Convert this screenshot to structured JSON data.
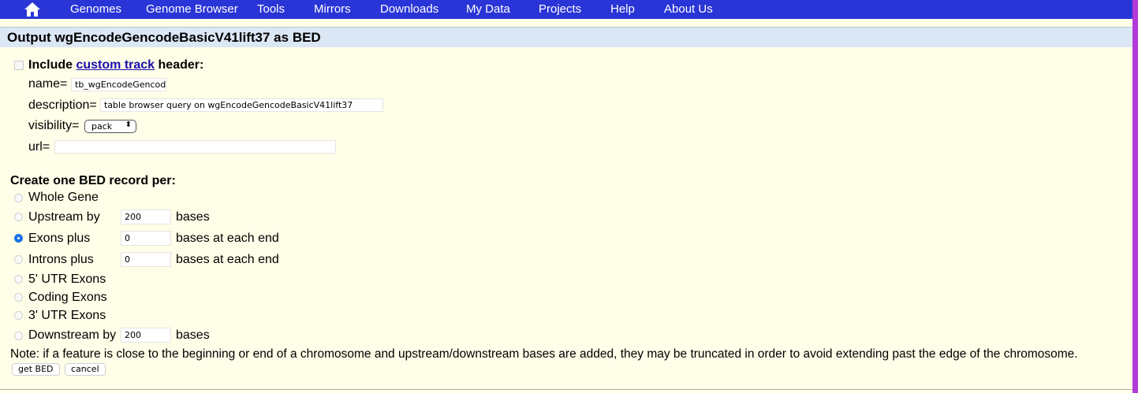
{
  "nav": {
    "items": [
      "Genomes",
      "Genome Browser",
      "Tools",
      "Mirrors",
      "Downloads",
      "My Data",
      "Projects",
      "Help",
      "About Us"
    ]
  },
  "page_title": "Output wgEncodeGencodeBasicV41lift37 as BED",
  "header_section": {
    "include_prefix": "Include",
    "include_link": "custom track",
    "include_suffix": "header:",
    "name_label": "name=",
    "name_value": "tb_wgEncodeGencode",
    "description_label": "description=",
    "description_value": "table browser query on wgEncodeGencodeBasicV41lift37",
    "visibility_label": "visibility=",
    "visibility_value": "pack",
    "url_label": "url=",
    "url_value": ""
  },
  "records": {
    "heading": "Create one BED record per:",
    "options": [
      {
        "label": "Whole Gene",
        "value": null,
        "suffix": null,
        "selected": false
      },
      {
        "label": "Upstream by",
        "value": "200",
        "suffix": "bases",
        "selected": false
      },
      {
        "label": "Exons plus",
        "value": "0",
        "suffix": "bases at each end",
        "selected": true
      },
      {
        "label": "Introns plus",
        "value": "0",
        "suffix": "bases at each end",
        "selected": false
      },
      {
        "label": "5' UTR Exons",
        "value": null,
        "suffix": null,
        "selected": false
      },
      {
        "label": "Coding Exons",
        "value": null,
        "suffix": null,
        "selected": false
      },
      {
        "label": "3' UTR Exons",
        "value": null,
        "suffix": null,
        "selected": false
      },
      {
        "label": "Downstream by",
        "value": "200",
        "suffix": "bases",
        "selected": false
      }
    ]
  },
  "note": "Note: if a feature is close to the beginning or end of a chromosome and upstream/downstream bases are added, they may be truncated in order to avoid extending past the edge of the chromosome.",
  "buttons": {
    "get_bed": "get BED",
    "cancel": "cancel"
  },
  "colors": {
    "nav_bg": "#2a35d7",
    "page_bg": "#fffee8",
    "title_bg": "#dce7f5",
    "right_strip": "#b23ad8",
    "link": "#1a0dab",
    "radio_selected": "#1a73e8"
  }
}
